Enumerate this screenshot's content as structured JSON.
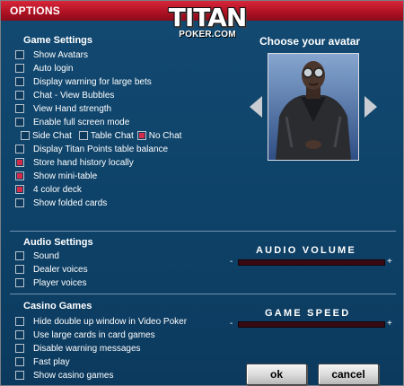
{
  "window": {
    "title": "OPTIONS"
  },
  "logo": {
    "main": "TITAN",
    "sub": "POKER.COM"
  },
  "game_settings": {
    "heading": "Game Settings",
    "items": [
      {
        "label": "Show Avatars",
        "checked": false
      },
      {
        "label": "Auto login",
        "checked": false
      },
      {
        "label": "Display warning for large bets",
        "checked": false
      },
      {
        "label": "Chat - View Bubbles",
        "checked": false
      },
      {
        "label": "View Hand strength",
        "checked": false
      },
      {
        "label": "Enable full screen mode",
        "checked": false
      },
      {
        "label": "Side Chat",
        "checked": false
      },
      {
        "label": "Display Titan Points table balance",
        "checked": false
      },
      {
        "label": "Store hand history locally",
        "checked": true
      },
      {
        "label": "Show mini-table",
        "checked": true
      },
      {
        "label": "4 color deck",
        "checked": true
      },
      {
        "label": "Show folded cards",
        "checked": false
      }
    ],
    "side_chat_extra": [
      {
        "label": "Table Chat",
        "checked": false
      },
      {
        "label": "No Chat",
        "checked": true
      }
    ]
  },
  "avatar": {
    "title": "Choose your avatar",
    "icon": "avatar-portrait"
  },
  "audio_settings": {
    "heading": "Audio Settings",
    "items": [
      {
        "label": "Sound",
        "checked": false
      },
      {
        "label": "Dealer voices",
        "checked": false
      },
      {
        "label": "Player voices",
        "checked": false
      }
    ],
    "slider": {
      "label": "AUDIO VOLUME",
      "minus": "-",
      "plus": "+",
      "level": 0
    }
  },
  "casino_games": {
    "heading": "Casino Games",
    "items": [
      {
        "label": "Hide double up window in Video Poker",
        "checked": false
      },
      {
        "label": "Use large cards in card games",
        "checked": false
      },
      {
        "label": "Disable warning messages",
        "checked": false
      },
      {
        "label": "Fast play",
        "checked": false
      },
      {
        "label": "Show casino games",
        "checked": false
      }
    ],
    "slider": {
      "label": "GAME SPEED",
      "minus": "-",
      "plus": "+",
      "level": 0
    }
  },
  "buttons": {
    "ok": "ok",
    "cancel": "cancel"
  },
  "colors": {
    "title_bar": "#c01a2c",
    "background": "#11456c",
    "checked_fill": "#d12a4a"
  }
}
